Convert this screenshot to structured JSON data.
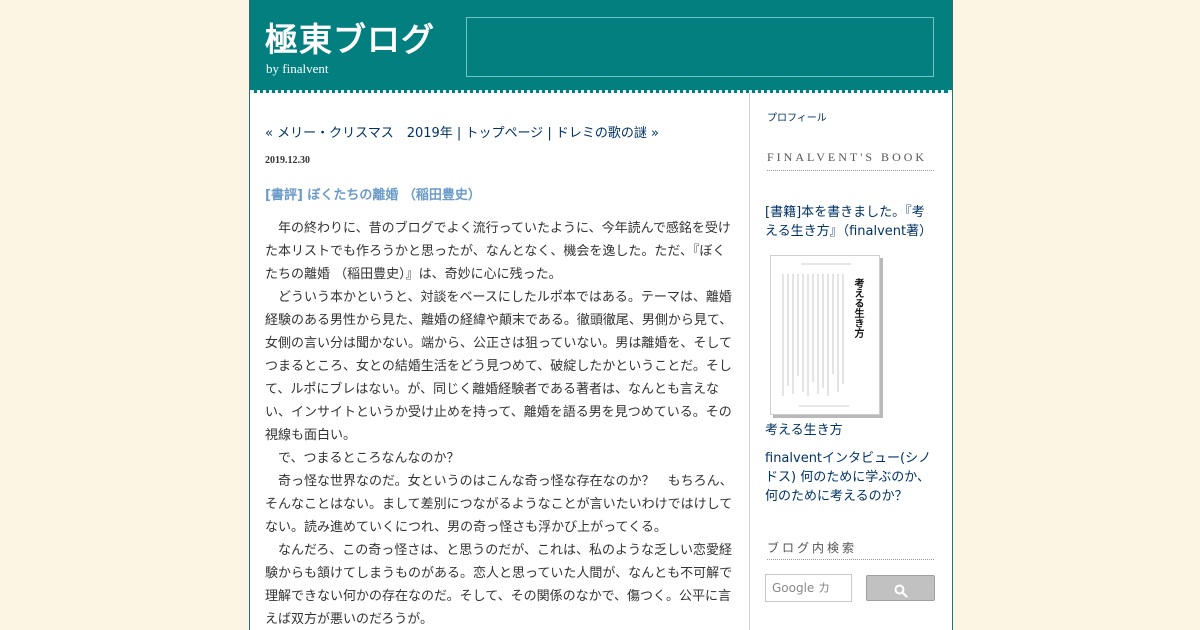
{
  "header": {
    "title": "極東ブログ",
    "author": "by finalvent"
  },
  "nav": {
    "prev_link": "« メリー・クリスマス　2019年",
    "separator": " | ",
    "top_link": "トップページ",
    "next_link": "ドレミの歌の謎 »"
  },
  "entry": {
    "date": "2019.12.30",
    "title": "[書評] ぼくたちの離婚 （稲田豊史）",
    "paragraphs": [
      "年の終わりに、昔のブログでよく流行っていたように、今年読んで感銘を受けた本リストでも作ろうかと思ったが、なんとなく、機会を逸した。ただ、『ぼくたちの離婚 （稲田豊史）』は、奇妙に心に残った。",
      "どういう本かというと、対談をベースにしたルポ本ではある。テーマは、離婚経験のある男性から見た、離婚の経緯や顛末である。徹頭徹尾、男側から見て、女側の言い分は聞かない。端から、公正さは狙っていない。男は離婚を、そしてつまるところ、女との結婚生活をどう見つめて、破綻したかということだ。そして、ルポにブレはない。が、同じく離婚経験者である著者は、なんとも言えない、インサイトというか受け止めを持って、離婚を語る男を見つめている。その視線も面白い。",
      "で、つまるところなんなのか？",
      "奇っ怪な世界なのだ。女というのはこんな奇っ怪な存在なのか？　もちろん、そんなことはない。まして差別につながるようなことが言いたいわけではけしてない。読み進めていくにつれ、男の奇っ怪さも浮かび上がってくる。",
      "なんだろ、この奇っ怪さは、と思うのだが、これは、私のような乏しい恋愛経験からも頷けてしまうものがある。恋人と思っていた人間が、なんとも不可解で理解できない何かの存在なのだ。そして、その関係のなかで、傷つく。公平に言えば双方が悪いのだろうが。"
    ]
  },
  "sidebar": {
    "profile_link": "プロフィール",
    "book_heading": "FINALVENT'S BOOK",
    "book_caption": "[書籍]本を書きました。『考える生き方』（finalvent著）",
    "book_cover_title": "考える生き方",
    "book_name_link": "考える生き方",
    "interview_link": "finalventインタビュー(シノドス) 何のために学ぶのか、何のために考えるのか？",
    "search_heading": "ブログ内検索",
    "search_placeholder": "Google カ"
  },
  "colors": {
    "background": "#fcf5e4",
    "banner": "#037f80",
    "link": "#003366",
    "entry_title": "#6b9bc9"
  }
}
